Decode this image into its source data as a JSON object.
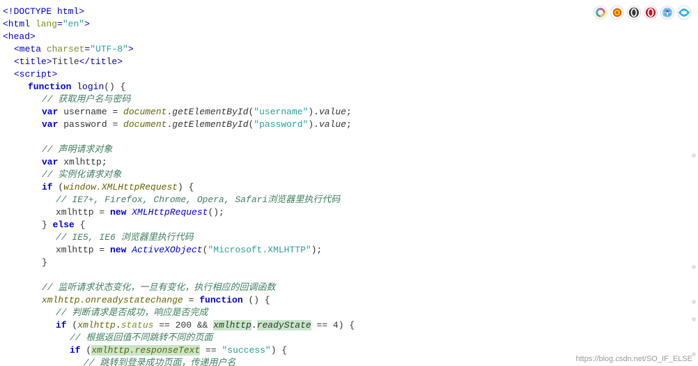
{
  "browser_icons": [
    {
      "name": "Chrome",
      "symbol": "C",
      "class": "icon-chrome"
    },
    {
      "name": "Firefox",
      "symbol": "F",
      "class": "icon-firefox"
    },
    {
      "name": "Opera Dark",
      "symbol": "O",
      "class": "icon-opera-dark"
    },
    {
      "name": "Opera",
      "symbol": "O",
      "class": "icon-opera"
    },
    {
      "name": "Safari",
      "symbol": "S",
      "class": "icon-safari"
    },
    {
      "name": "IE",
      "symbol": "e",
      "class": "icon-ie"
    }
  ],
  "bottom_link": "https://blog.csdn.net/SO_IF_ELSE",
  "code_lines": [
    {
      "id": 1,
      "indent": 0,
      "content": "&lt;!DOCTYPE html&gt;"
    },
    {
      "id": 2,
      "indent": 0,
      "content": "&lt;html lang=\"en\"&gt;"
    },
    {
      "id": 3,
      "indent": 0,
      "content": "&lt;head&gt;"
    },
    {
      "id": 4,
      "indent": 1,
      "content": "&lt;meta charset=\"UTF-8\"&gt;"
    },
    {
      "id": 5,
      "indent": 1,
      "content": "&lt;title&gt;Title&lt;/title&gt;"
    },
    {
      "id": 6,
      "indent": 1,
      "content": "&lt;script&gt;"
    },
    {
      "id": 7,
      "indent": 2,
      "content": "function login() {"
    },
    {
      "id": 8,
      "indent": 3,
      "content": "// 获取用户名与密码"
    },
    {
      "id": 9,
      "indent": 3,
      "content": "var username = document.getElementById(\"username\").value;"
    },
    {
      "id": 10,
      "indent": 3,
      "content": "var password = document.getElementById(\"password\").value;"
    },
    {
      "id": 11,
      "indent": 0,
      "content": ""
    },
    {
      "id": 12,
      "indent": 3,
      "content": "// 声明请求对象"
    },
    {
      "id": 13,
      "indent": 3,
      "content": "var xmlhttp;"
    },
    {
      "id": 14,
      "indent": 3,
      "content": "// 实例化请求对象"
    },
    {
      "id": 15,
      "indent": 3,
      "content": "if (window.XMLHttpRequest) {"
    },
    {
      "id": 16,
      "indent": 4,
      "content": "// IE7+, Firefox, Chrome, Opera, Safari浏览器里执行代码"
    },
    {
      "id": 17,
      "indent": 4,
      "content": "xmlhttp = new XMLHttpRequest();"
    },
    {
      "id": 18,
      "indent": 3,
      "content": "} else {"
    },
    {
      "id": 19,
      "indent": 4,
      "content": "// IE5, IE6 浏览器里执行代码"
    },
    {
      "id": 20,
      "indent": 4,
      "content": "xmlhttp = new ActiveXObject(\"Microsoft.XMLHTTP\");"
    },
    {
      "id": 21,
      "indent": 3,
      "content": "}"
    },
    {
      "id": 22,
      "indent": 0,
      "content": ""
    },
    {
      "id": 23,
      "indent": 3,
      "content": "// 监听请求状态变化，一旦有变化，执行相应的回调函数"
    },
    {
      "id": 24,
      "indent": 3,
      "content": "xmlhttp.onreadystatechange = function () {"
    },
    {
      "id": 25,
      "indent": 4,
      "content": "// 判断请求是否成功，响应是否完成"
    },
    {
      "id": 26,
      "indent": 4,
      "content": "if (xmlhttp.status == 200 && xmlhttp.readyState == 4) {"
    },
    {
      "id": 27,
      "indent": 5,
      "content": "// 根据返回值不同跳转不同的页面"
    },
    {
      "id": 28,
      "indent": 5,
      "content": "if (xmlhttp.responseText == \"success\") {"
    },
    {
      "id": 29,
      "indent": 6,
      "content": "// 跳转到登录成功页面，传递用户名"
    }
  ]
}
